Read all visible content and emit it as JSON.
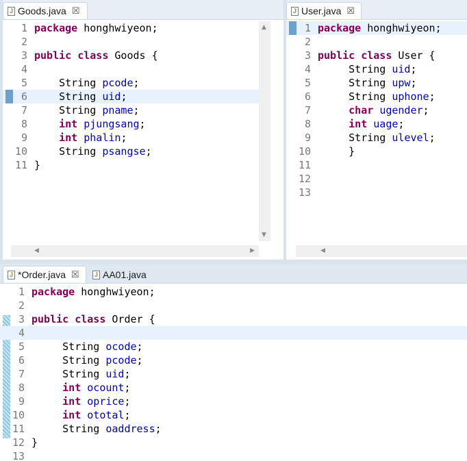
{
  "goods": {
    "tab": {
      "icon": "J",
      "label": "Goods.java",
      "close": "☒"
    },
    "lines": [
      {
        "n": "1",
        "t": [
          {
            "k": "kw",
            "s": "package"
          },
          {
            "s": " honghwiyeon;"
          }
        ]
      },
      {
        "n": "2",
        "t": []
      },
      {
        "n": "3",
        "t": [
          {
            "k": "kw",
            "s": "public"
          },
          {
            "s": " "
          },
          {
            "k": "kw",
            "s": "class"
          },
          {
            "s": " Goods {"
          }
        ]
      },
      {
        "n": "4",
        "t": []
      },
      {
        "n": "5",
        "t": [
          {
            "s": "    String "
          },
          {
            "k": "fld",
            "s": "pcode"
          },
          {
            "s": ";"
          }
        ]
      },
      {
        "n": "6",
        "t": [
          {
            "s": "    String "
          },
          {
            "k": "fld",
            "s": "uid"
          },
          {
            "s": ";"
          }
        ],
        "cur": true,
        "marker": true
      },
      {
        "n": "7",
        "t": [
          {
            "s": "    String "
          },
          {
            "k": "fld",
            "s": "pname"
          },
          {
            "s": ";"
          }
        ]
      },
      {
        "n": "8",
        "t": [
          {
            "s": "    "
          },
          {
            "k": "kw",
            "s": "int"
          },
          {
            "s": " "
          },
          {
            "k": "fld",
            "s": "pjungsang"
          },
          {
            "s": ";"
          }
        ]
      },
      {
        "n": "9",
        "t": [
          {
            "s": "    "
          },
          {
            "k": "kw",
            "s": "int"
          },
          {
            "s": " "
          },
          {
            "k": "fld",
            "s": "phalin"
          },
          {
            "s": ";"
          }
        ]
      },
      {
        "n": "10",
        "t": [
          {
            "s": "    String "
          },
          {
            "k": "fld",
            "s": "psangse"
          },
          {
            "s": ";"
          }
        ]
      },
      {
        "n": "11",
        "t": [
          {
            "s": "}"
          }
        ]
      }
    ]
  },
  "user": {
    "tab": {
      "icon": "J",
      "label": "User.java",
      "close": "☒"
    },
    "lines": [
      {
        "n": "1",
        "t": [
          {
            "k": "kw",
            "s": "package"
          },
          {
            "s": " honghwiyeon;"
          }
        ],
        "cur": true,
        "marker": true
      },
      {
        "n": "2",
        "t": []
      },
      {
        "n": "3",
        "t": [
          {
            "k": "kw",
            "s": "public"
          },
          {
            "s": " "
          },
          {
            "k": "kw",
            "s": "class"
          },
          {
            "s": " User {"
          }
        ]
      },
      {
        "n": "4",
        "t": [
          {
            "s": "     String "
          },
          {
            "k": "fld",
            "s": "uid"
          },
          {
            "s": ";"
          }
        ]
      },
      {
        "n": "5",
        "t": [
          {
            "s": "     String "
          },
          {
            "k": "fld",
            "s": "upw"
          },
          {
            "s": ";"
          }
        ]
      },
      {
        "n": "6",
        "t": [
          {
            "s": "     String "
          },
          {
            "k": "fld",
            "s": "uphone"
          },
          {
            "s": ";"
          }
        ]
      },
      {
        "n": "7",
        "t": [
          {
            "s": "     "
          },
          {
            "k": "kw",
            "s": "char"
          },
          {
            "s": " "
          },
          {
            "k": "fld",
            "s": "ugender"
          },
          {
            "s": ";"
          }
        ]
      },
      {
        "n": "8",
        "t": [
          {
            "s": "     "
          },
          {
            "k": "kw",
            "s": "int"
          },
          {
            "s": " "
          },
          {
            "k": "fld",
            "s": "uage"
          },
          {
            "s": ";"
          }
        ]
      },
      {
        "n": "9",
        "t": [
          {
            "s": "     String "
          },
          {
            "k": "fld",
            "s": "ulevel"
          },
          {
            "s": ";"
          }
        ]
      },
      {
        "n": "10",
        "t": [
          {
            "s": "     }"
          }
        ]
      },
      {
        "n": "11",
        "t": []
      },
      {
        "n": "12",
        "t": []
      },
      {
        "n": "13",
        "t": []
      }
    ]
  },
  "order": {
    "tabs": [
      {
        "icon": "J",
        "label": "*Order.java",
        "close": "☒",
        "active": true
      },
      {
        "icon": "J",
        "label": "AA01.java",
        "active": false
      }
    ],
    "lines": [
      {
        "n": "1",
        "t": [
          {
            "k": "kw",
            "s": "package"
          },
          {
            "s": " honghwiyeon;"
          }
        ]
      },
      {
        "n": "2",
        "t": []
      },
      {
        "n": "3",
        "t": [
          {
            "k": "kw",
            "s": "public"
          },
          {
            "s": " "
          },
          {
            "k": "kw",
            "s": "class"
          },
          {
            "s": " Order {"
          }
        ]
      },
      {
        "n": "4",
        "t": [],
        "cur": true
      },
      {
        "n": "5",
        "t": [
          {
            "s": "     String "
          },
          {
            "k": "fld",
            "s": "ocode"
          },
          {
            "s": ";"
          }
        ]
      },
      {
        "n": "6",
        "t": [
          {
            "s": "     String "
          },
          {
            "k": "fld",
            "s": "pcode"
          },
          {
            "s": ";"
          }
        ]
      },
      {
        "n": "7",
        "t": [
          {
            "s": "     String "
          },
          {
            "k": "fld",
            "s": "uid"
          },
          {
            "s": ";"
          }
        ]
      },
      {
        "n": "8",
        "t": [
          {
            "s": "     "
          },
          {
            "k": "kw",
            "s": "int"
          },
          {
            "s": " "
          },
          {
            "k": "fld",
            "s": "ocount"
          },
          {
            "s": ";"
          }
        ]
      },
      {
        "n": "9",
        "t": [
          {
            "s": "     "
          },
          {
            "k": "kw",
            "s": "int"
          },
          {
            "s": " "
          },
          {
            "k": "fld",
            "s": "oprice"
          },
          {
            "s": ";"
          }
        ]
      },
      {
        "n": "10",
        "t": [
          {
            "s": "     "
          },
          {
            "k": "kw",
            "s": "int"
          },
          {
            "s": " "
          },
          {
            "k": "fld",
            "s": "ototal"
          },
          {
            "s": ";"
          }
        ]
      },
      {
        "n": "11",
        "t": [
          {
            "s": "     String "
          },
          {
            "k": "fld",
            "s": "oaddress"
          },
          {
            "s": ";"
          }
        ]
      },
      {
        "n": "12",
        "t": [
          {
            "s": "}"
          }
        ]
      },
      {
        "n": "13",
        "t": []
      }
    ]
  },
  "icons": {
    "scroll_up": "▲",
    "scroll_down": "▼",
    "scroll_left": "◀",
    "scroll_right": "▶"
  },
  "colors": {
    "keyword": "#7f0055",
    "field": "#0000c0",
    "line_number": "#787878",
    "current_line": "#e8f2fe"
  }
}
